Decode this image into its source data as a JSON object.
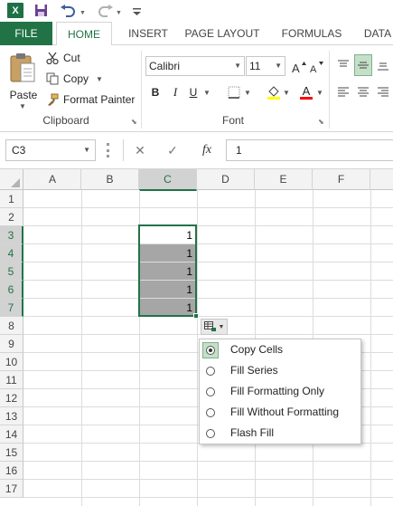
{
  "quick_access": {
    "app_logo": "X",
    "icons": [
      "excel-logo-icon",
      "save-icon",
      "undo-icon",
      "redo-icon",
      "customize-icon"
    ]
  },
  "tabs": {
    "file": "FILE",
    "home": "HOME",
    "insert": "INSERT",
    "page_layout": "PAGE LAYOUT",
    "formulas": "FORMULAS",
    "data": "DATA"
  },
  "clipboard": {
    "paste_label": "Paste",
    "cut_label": "Cut",
    "copy_label": "Copy",
    "format_painter_label": "Format Painter",
    "group_label": "Clipboard"
  },
  "font": {
    "font_name": "Calibri",
    "font_size": "11",
    "group_label": "Font",
    "bold": "B",
    "italic": "I",
    "underline": "U",
    "font_color_letter": "A"
  },
  "formula_bar": {
    "name_box": "C3",
    "cancel_icon": "✕",
    "enter_icon": "✓",
    "fx": "fx",
    "value": "1"
  },
  "grid": {
    "columns": [
      "A",
      "B",
      "C",
      "D",
      "E",
      "F"
    ],
    "selected_column": "C",
    "rows": [
      "1",
      "2",
      "3",
      "4",
      "5",
      "6",
      "7",
      "8",
      "9",
      "10",
      "11",
      "12",
      "13",
      "14",
      "15",
      "16",
      "17"
    ],
    "selected_rows": [
      "3",
      "4",
      "5",
      "6",
      "7"
    ],
    "cells_c3_c7": [
      "1",
      "1",
      "1",
      "1",
      "1"
    ]
  },
  "autofill_menu": {
    "options": [
      {
        "label": "Copy Cells",
        "checked": true
      },
      {
        "label": "Fill Series",
        "checked": false
      },
      {
        "label": "Fill Formatting Only",
        "checked": false
      },
      {
        "label": "Fill Without Formatting",
        "checked": false
      },
      {
        "label": "Flash Fill",
        "checked": false
      }
    ]
  },
  "colors": {
    "accent": "#217346",
    "selection_fill": "#a6a6a6",
    "highlight_yellow": "#ffff00",
    "font_red": "#ff0000"
  }
}
